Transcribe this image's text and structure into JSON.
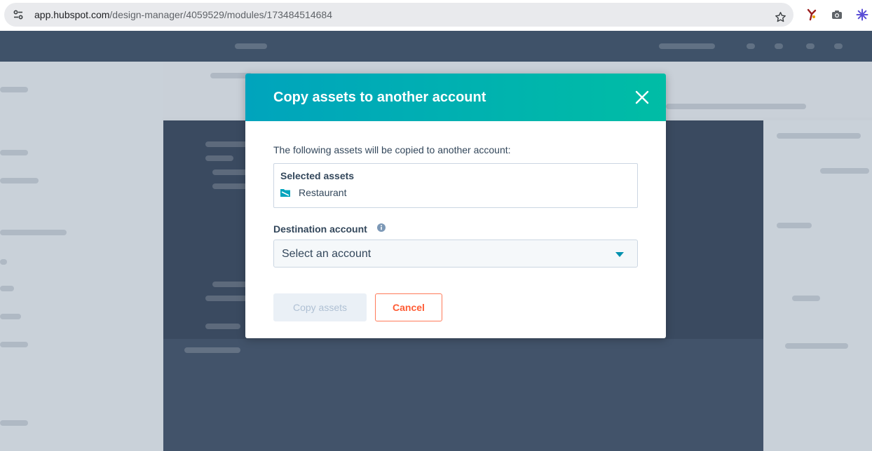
{
  "browser": {
    "url_host": "app.hubspot.com",
    "url_path": "/design-manager/4059529/modules/173484514684"
  },
  "modal": {
    "title": "Copy assets to another account",
    "intro": "The following assets will be copied to another account:",
    "selected_assets_heading": "Selected assets",
    "assets": [
      {
        "name": "Restaurant",
        "icon": "module-icon"
      }
    ],
    "destination_label": "Destination account",
    "destination_placeholder": "Select an account",
    "copy_button": "Copy assets",
    "cancel_button": "Cancel"
  },
  "colors": {
    "header_gradient_start": "#00a4bd",
    "header_gradient_end": "#00bda5",
    "text": "#33475b",
    "cancel_accent": "#ff7a59",
    "disabled_text": "#b0c1d4"
  }
}
